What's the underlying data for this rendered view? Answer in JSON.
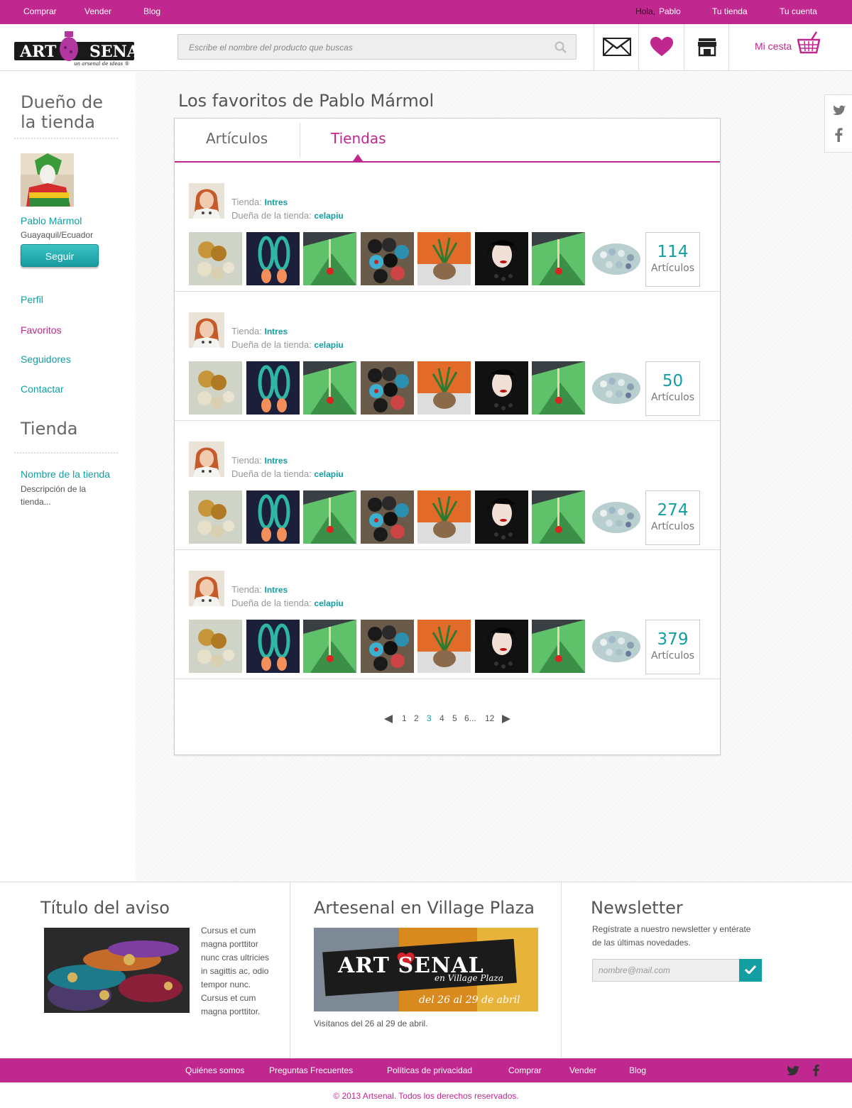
{
  "topbar": {
    "links": [
      "Comprar",
      "Vender",
      "Blog"
    ],
    "greeting": "Hola,",
    "user": "Pablo",
    "your_shop": "Tu tienda",
    "your_account": "Tu cuenta"
  },
  "header": {
    "logo_text": "ART SENAL",
    "logo_tagline": "un arsenal de ideas",
    "search_placeholder": "Escribe el nombre del producto que buscas",
    "cart_label": "Mi cesta"
  },
  "sidebar": {
    "owner_heading_1": "Dueño de",
    "owner_heading_2": "la tienda",
    "owner_name": "Pablo Mármol",
    "owner_location": "Guayaquil/Ecuador",
    "follow_label": "Seguir",
    "nav": [
      "Perfil",
      "Favoritos",
      "Seguidores",
      "Contactar"
    ],
    "shop_heading": "Tienda",
    "shop_name": "Nombre de la tienda",
    "shop_description": "Descripción de la tienda..."
  },
  "main": {
    "title": "Los favoritos de Pablo Mármol",
    "tabs": [
      "Artículos",
      "Tiendas"
    ],
    "active_tab": "Tiendas",
    "shop_label": "Tienda:",
    "owner_label": "Dueña de la tienda:",
    "shops": [
      {
        "name": "Intres",
        "owner": "celapiu",
        "count": "114",
        "count_label": "Artículos"
      },
      {
        "name": "Intres",
        "owner": "celapiu",
        "count": "50",
        "count_label": "Artículos"
      },
      {
        "name": "Intres",
        "owner": "celapiu",
        "count": "274",
        "count_label": "Artículos"
      },
      {
        "name": "Intres",
        "owner": "celapiu",
        "count": "379",
        "count_label": "Artículos"
      }
    ],
    "pagination": {
      "pages": [
        "1",
        "2",
        "3",
        "4",
        "5",
        "6...",
        "12"
      ],
      "current": "3"
    }
  },
  "footer": {
    "notice_title": "Título del aviso",
    "notice_text": "Cursus et cum magna porttitor nunc cras ultricies in sagittis ac, odio tempor nunc. Cursus et cum magna porttitor.",
    "event_title": "Artesenal en Village Plaza",
    "event_banner_line1": "ART SENAL",
    "event_banner_line2": "en Village Plaza",
    "event_banner_line3": "del 26 al 29 de abril",
    "event_caption": "Visítanos del 26 al 29 de abril.",
    "newsletter_title": "Newsletter",
    "newsletter_text": "Regístrate a nuestro newsletter y entérate de las últimas novedades.",
    "newsletter_placeholder": "nombre@mail.com"
  },
  "bottombar": {
    "links": [
      "Quiénes somos",
      "Preguntas Frecuentes",
      "Políticas de privacidad",
      "Comprar",
      "Vender",
      "Blog"
    ],
    "copyright": "© 2013 Artsenal. Todos los derechos reservados."
  },
  "colors": {
    "brand": "#c0278f",
    "accent": "#139ea1"
  }
}
